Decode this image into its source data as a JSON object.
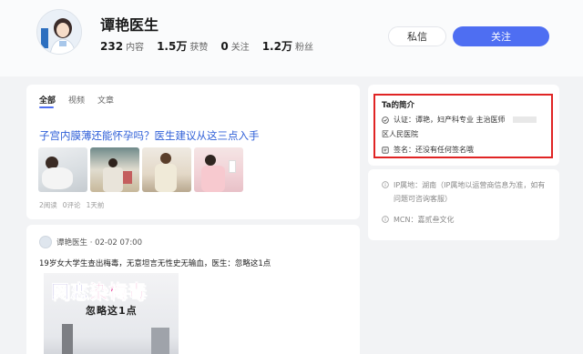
{
  "profile": {
    "name": "谭艳医生",
    "stats": [
      {
        "value": "232",
        "label": "内容"
      },
      {
        "value": "1.5万",
        "label": "获赞"
      },
      {
        "value": "0",
        "label": "关注"
      },
      {
        "value": "1.2万",
        "label": "粉丝"
      }
    ],
    "message_label": "私信",
    "follow_label": "关注"
  },
  "tabs": [
    "全部",
    "视频",
    "文章"
  ],
  "post1": {
    "title": "子宫内膜薄还能怀孕吗？医生建议从这三点入手",
    "reads": "2阅读",
    "comments": "0评论",
    "time": "1天前"
  },
  "post2": {
    "author_line": "谭艳医生 · 02-02 07:00",
    "text": "19岁女大学生查出梅毒，无意坦言无性史无输血，医生：忽略这1点",
    "cover_title_a": "网恋",
    "cover_title_b": "染梅毒",
    "cover_sub": "忽略这1点"
  },
  "about": {
    "title": "Ta的简介",
    "cert_line": "认证：谭艳，妇产科专业 主治医师 ",
    "cert_line2": "区人民医院",
    "signature": "签名：还没有任何签名哦"
  },
  "info": {
    "ip": "IP属地：湖南（IP属地以运营商信息为准，如有问题可咨询客服）",
    "mcn": "MCN：嘉贰叁文化"
  },
  "colors": {
    "accent": "#4e6ef2",
    "link": "#3060d8",
    "highlight_border": "#e02424"
  }
}
